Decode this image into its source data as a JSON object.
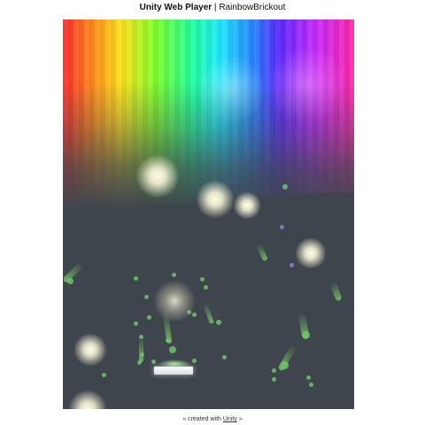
{
  "header": {
    "player_name": "Unity Web Player",
    "separator": " | ",
    "game_title": "RainbowBrickout"
  },
  "footer": {
    "prefix": "« created with ",
    "link_text": "Unity",
    "suffix": " »"
  },
  "colors": {
    "background": "#3f454d",
    "particle": "#6fc46a",
    "bloom": "#fff9d6",
    "paddle": "#ffffff"
  }
}
